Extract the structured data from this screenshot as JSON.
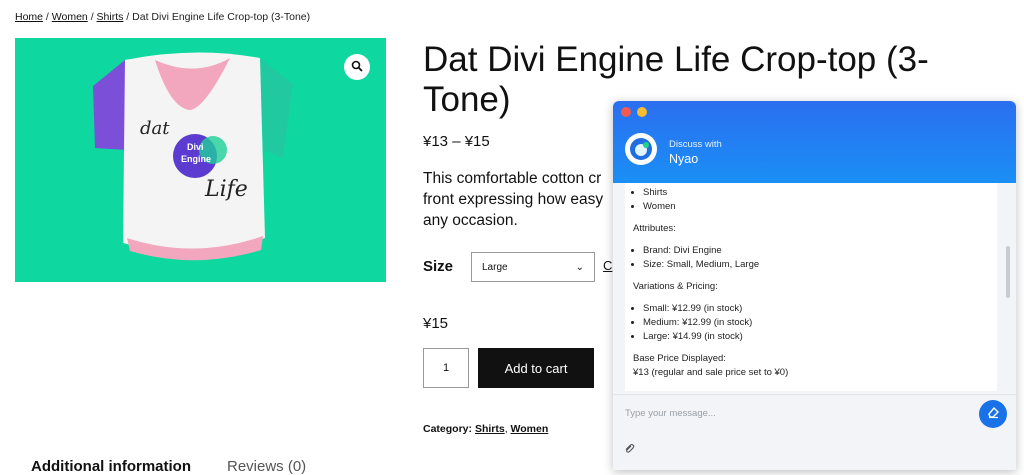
{
  "breadcrumb": {
    "home": "Home",
    "sep1": " / ",
    "women": "Women",
    "sep2": " / ",
    "shirts": "Shirts",
    "current": " / Dat Divi Engine Life Crop-top (3-Tone)"
  },
  "product": {
    "title": "Dat Divi Engine Life Crop-top (3-Tone)",
    "price_range": "¥13 – ¥15",
    "description": "This comfortable cotton crop-top front expressing how easy any occasion.",
    "desc_line1": "This comfortable cotton cr",
    "desc_line2": "front expressing how easy",
    "desc_line3": "any occasion.",
    "shirt_text": {
      "dat": "dat",
      "divi": "Divi",
      "engine": "Engine",
      "life": "Life"
    }
  },
  "variation": {
    "size_label": "Size",
    "selected": "Large",
    "clear_link": "C",
    "price": "¥15"
  },
  "cart": {
    "quantity": "1",
    "add_label": "Add to cart"
  },
  "category": {
    "label": "Category:",
    "shirts": "Shirts",
    "comma": ", ",
    "women": "Women"
  },
  "tabs": {
    "additional": "Additional information",
    "reviews": "Reviews (0)"
  },
  "chat": {
    "header_sub": "Discuss with",
    "header_name": "Nyao",
    "categories": [
      "Shirts",
      "Women"
    ],
    "attributes_heading": "Attributes:",
    "attributes": [
      "Brand: Divi Engine",
      "Size: Small, Medium, Large"
    ],
    "variations_heading": "Variations & Pricing:",
    "variations": [
      "Small: ¥12.99 (in stock)",
      "Medium: ¥12.99 (in stock)",
      "Large: ¥14.99 (in stock)"
    ],
    "base_heading": "Base Price Displayed:",
    "base_text": "¥13 (regular and sale price set to ¥0)",
    "input_placeholder": "Type your message..."
  },
  "icons": {
    "zoom": "search-icon",
    "select": "chevron-down-icon",
    "send": "eraser-icon",
    "attach": "paperclip-icon"
  },
  "colors": {
    "hero_bg": "#0ed89f",
    "chat_header": "#1a8ff5",
    "send_button": "#1a72e8"
  }
}
